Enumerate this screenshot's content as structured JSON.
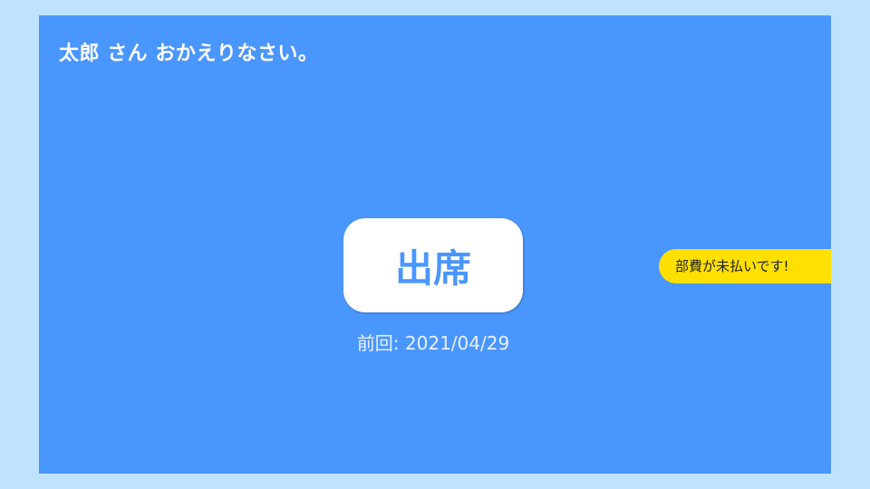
{
  "header": {
    "greeting": "太郎 さん おかえりなさい。"
  },
  "attendance": {
    "button_label": "出席",
    "last_visit": "前回: 2021/04/29"
  },
  "notice": {
    "fee_unpaid": "部費が未払いです!"
  },
  "colors": {
    "page_background": "#bfe3ff",
    "panel_background": "#4a96ff",
    "button_background": "#ffffff",
    "button_text": "#4a96ff",
    "badge_background": "#ffe000"
  }
}
